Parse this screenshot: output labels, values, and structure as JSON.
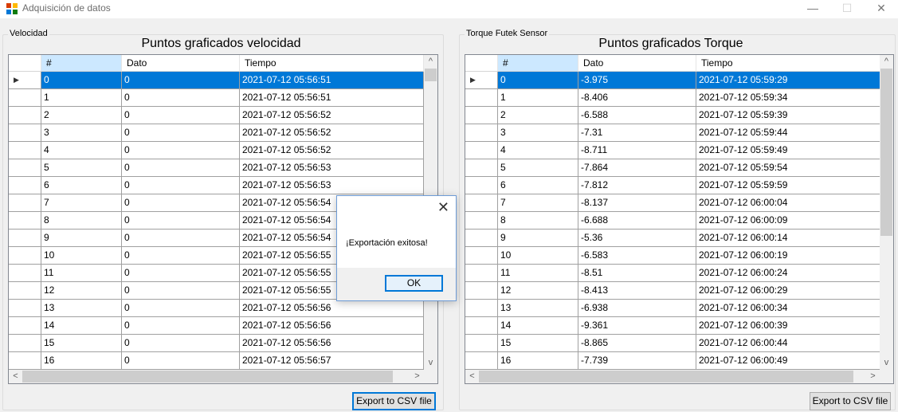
{
  "window": {
    "title": "Adquisición de datos",
    "minimize": "—",
    "maximize": "☐",
    "close": "✕"
  },
  "left": {
    "group_label": "Velocidad",
    "title": "Puntos graficados velocidad",
    "columns": [
      "#",
      "Dato",
      "Tiempo"
    ],
    "rows": [
      [
        "0",
        "0",
        "2021-07-12 05:56:51"
      ],
      [
        "1",
        "0",
        "2021-07-12 05:56:51"
      ],
      [
        "2",
        "0",
        "2021-07-12 05:56:52"
      ],
      [
        "3",
        "0",
        "2021-07-12 05:56:52"
      ],
      [
        "4",
        "0",
        "2021-07-12 05:56:52"
      ],
      [
        "5",
        "0",
        "2021-07-12 05:56:53"
      ],
      [
        "6",
        "0",
        "2021-07-12 05:56:53"
      ],
      [
        "7",
        "0",
        "2021-07-12 05:56:54"
      ],
      [
        "8",
        "0",
        "2021-07-12 05:56:54"
      ],
      [
        "9",
        "0",
        "2021-07-12 05:56:54"
      ],
      [
        "10",
        "0",
        "2021-07-12 05:56:55"
      ],
      [
        "11",
        "0",
        "2021-07-12 05:56:55"
      ],
      [
        "12",
        "0",
        "2021-07-12 05:56:55"
      ],
      [
        "13",
        "0",
        "2021-07-12 05:56:56"
      ],
      [
        "14",
        "0",
        "2021-07-12 05:56:56"
      ],
      [
        "15",
        "0",
        "2021-07-12 05:56:56"
      ],
      [
        "16",
        "0",
        "2021-07-12 05:56:57"
      ]
    ],
    "selected_row": 0,
    "export_label": "Export to CSV file"
  },
  "right": {
    "group_label": "Torque Futek Sensor",
    "title": "Puntos graficados Torque",
    "columns": [
      "#",
      "Dato",
      "Tiempo"
    ],
    "rows": [
      [
        "0",
        "-3.975",
        "2021-07-12 05:59:29"
      ],
      [
        "1",
        "-8.406",
        "2021-07-12 05:59:34"
      ],
      [
        "2",
        "-6.588",
        "2021-07-12 05:59:39"
      ],
      [
        "3",
        "-7.31",
        "2021-07-12 05:59:44"
      ],
      [
        "4",
        "-8.711",
        "2021-07-12 05:59:49"
      ],
      [
        "5",
        "-7.864",
        "2021-07-12 05:59:54"
      ],
      [
        "6",
        "-7.812",
        "2021-07-12 05:59:59"
      ],
      [
        "7",
        "-8.137",
        "2021-07-12 06:00:04"
      ],
      [
        "8",
        "-6.688",
        "2021-07-12 06:00:09"
      ],
      [
        "9",
        "-5.36",
        "2021-07-12 06:00:14"
      ],
      [
        "10",
        "-6.583",
        "2021-07-12 06:00:19"
      ],
      [
        "11",
        "-8.51",
        "2021-07-12 06:00:24"
      ],
      [
        "12",
        "-8.413",
        "2021-07-12 06:00:29"
      ],
      [
        "13",
        "-6.938",
        "2021-07-12 06:00:34"
      ],
      [
        "14",
        "-9.361",
        "2021-07-12 06:00:39"
      ],
      [
        "15",
        "-8.865",
        "2021-07-12 06:00:44"
      ],
      [
        "16",
        "-7.739",
        "2021-07-12 06:00:49"
      ]
    ],
    "selected_row": 0,
    "export_label": "Export to CSV file"
  },
  "dialog": {
    "message": "¡Exportación exitosa!",
    "ok_label": "OK",
    "close": "✕"
  },
  "icons": {
    "row_pointer": "▶",
    "scroll_up": "^",
    "scroll_down": "v",
    "scroll_left": "<",
    "scroll_right": ">"
  },
  "colors": {
    "selection": "#0078d7",
    "active_header": "#cce8ff"
  }
}
